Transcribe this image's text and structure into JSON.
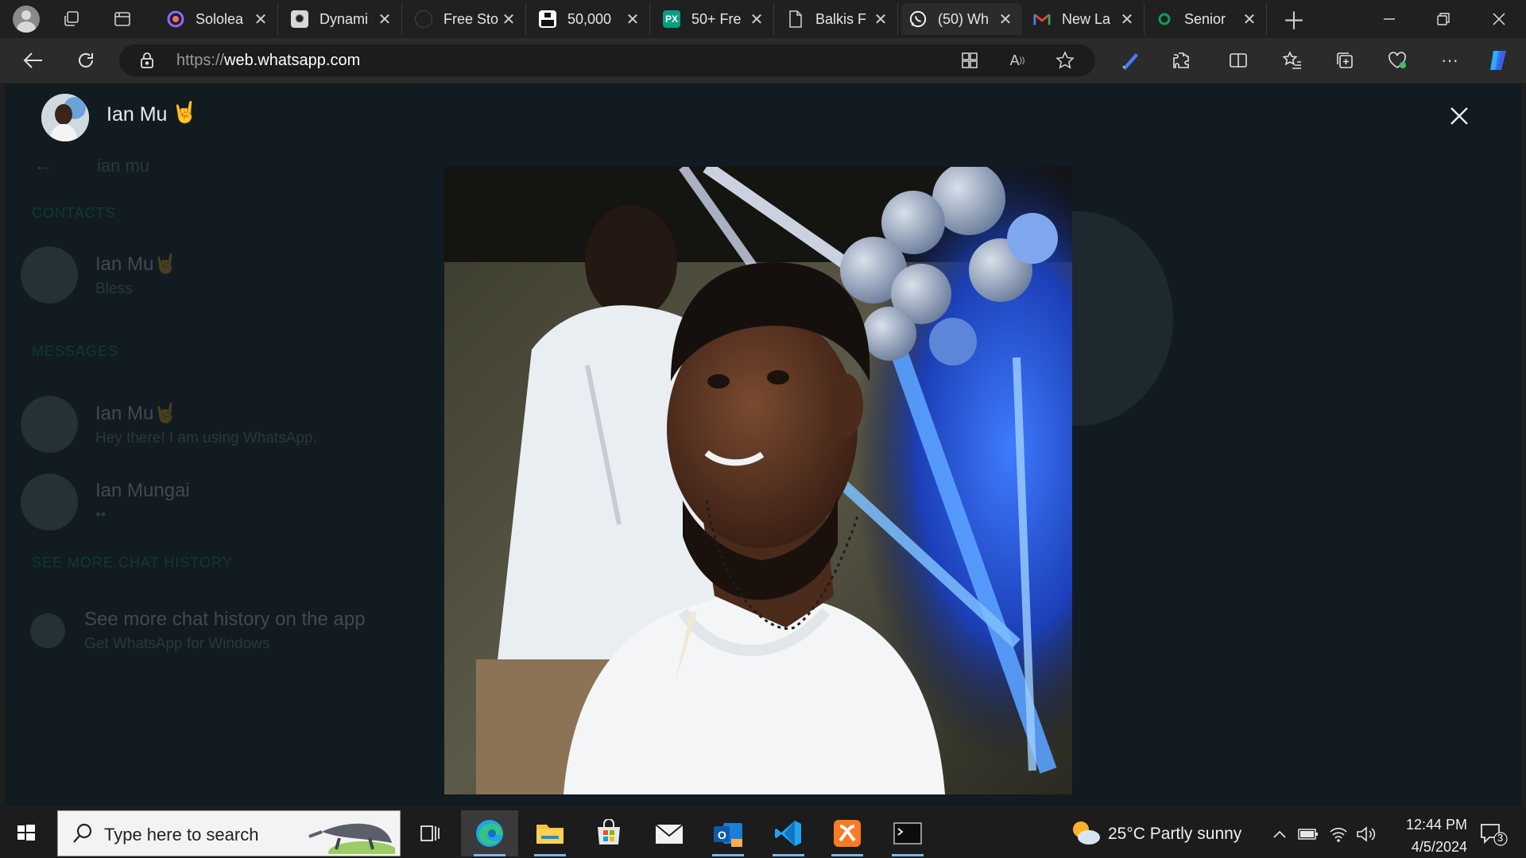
{
  "browser": {
    "tabs": [
      {
        "title": "Sololea",
        "icon": "sololearn-icon",
        "color": "#7b5cff"
      },
      {
        "title": "Dynami",
        "icon": "chatgpt-icon",
        "color": "#3d3d3d"
      },
      {
        "title": "Free Sto",
        "icon": "camera-icon",
        "color": "#2b2b2b"
      },
      {
        "title": "50,000",
        "icon": "unsplash-icon",
        "color": "#ffffff"
      },
      {
        "title": "50+ Fre",
        "icon": "pexels-icon",
        "color": "#05a081"
      },
      {
        "title": "Balkis F",
        "icon": "document-icon",
        "color": "#2b2b2b"
      },
      {
        "title": "(50) Wh",
        "icon": "whatsapp-icon",
        "color": "#25d366"
      },
      {
        "title": "New La",
        "icon": "gmail-icon",
        "color": "#ea4335"
      },
      {
        "title": "Senior",
        "icon": "ring-icon",
        "color": "#0f9d58"
      }
    ],
    "active_tab": 6,
    "url_prefix": "https://",
    "url_domain": "web.whatsapp.com"
  },
  "viewer": {
    "contact_name": "Ian Mu",
    "emoji": "🤘"
  },
  "background_chats": {
    "search_text": "ian mu",
    "section_contacts": "CONTACTS",
    "section_messages": "MESSAGES",
    "section_history": "SEE MORE CHAT HISTORY",
    "rows": [
      {
        "name": "Ian Mu🤘",
        "subtitle": "Bless"
      },
      {
        "name": "Ian Mu🤘",
        "subtitle": "Hey there! I am using WhatsApp."
      },
      {
        "name": "Ian Mungai",
        "subtitle": "••"
      }
    ],
    "history_title": "See more chat history on the app",
    "history_sub": "Get WhatsApp for Windows"
  },
  "taskbar": {
    "search_placeholder": "Type here to search",
    "weather": "25°C  Partly sunny",
    "time": "12:44 PM",
    "date": "4/5/2024",
    "notification_count": "3"
  }
}
